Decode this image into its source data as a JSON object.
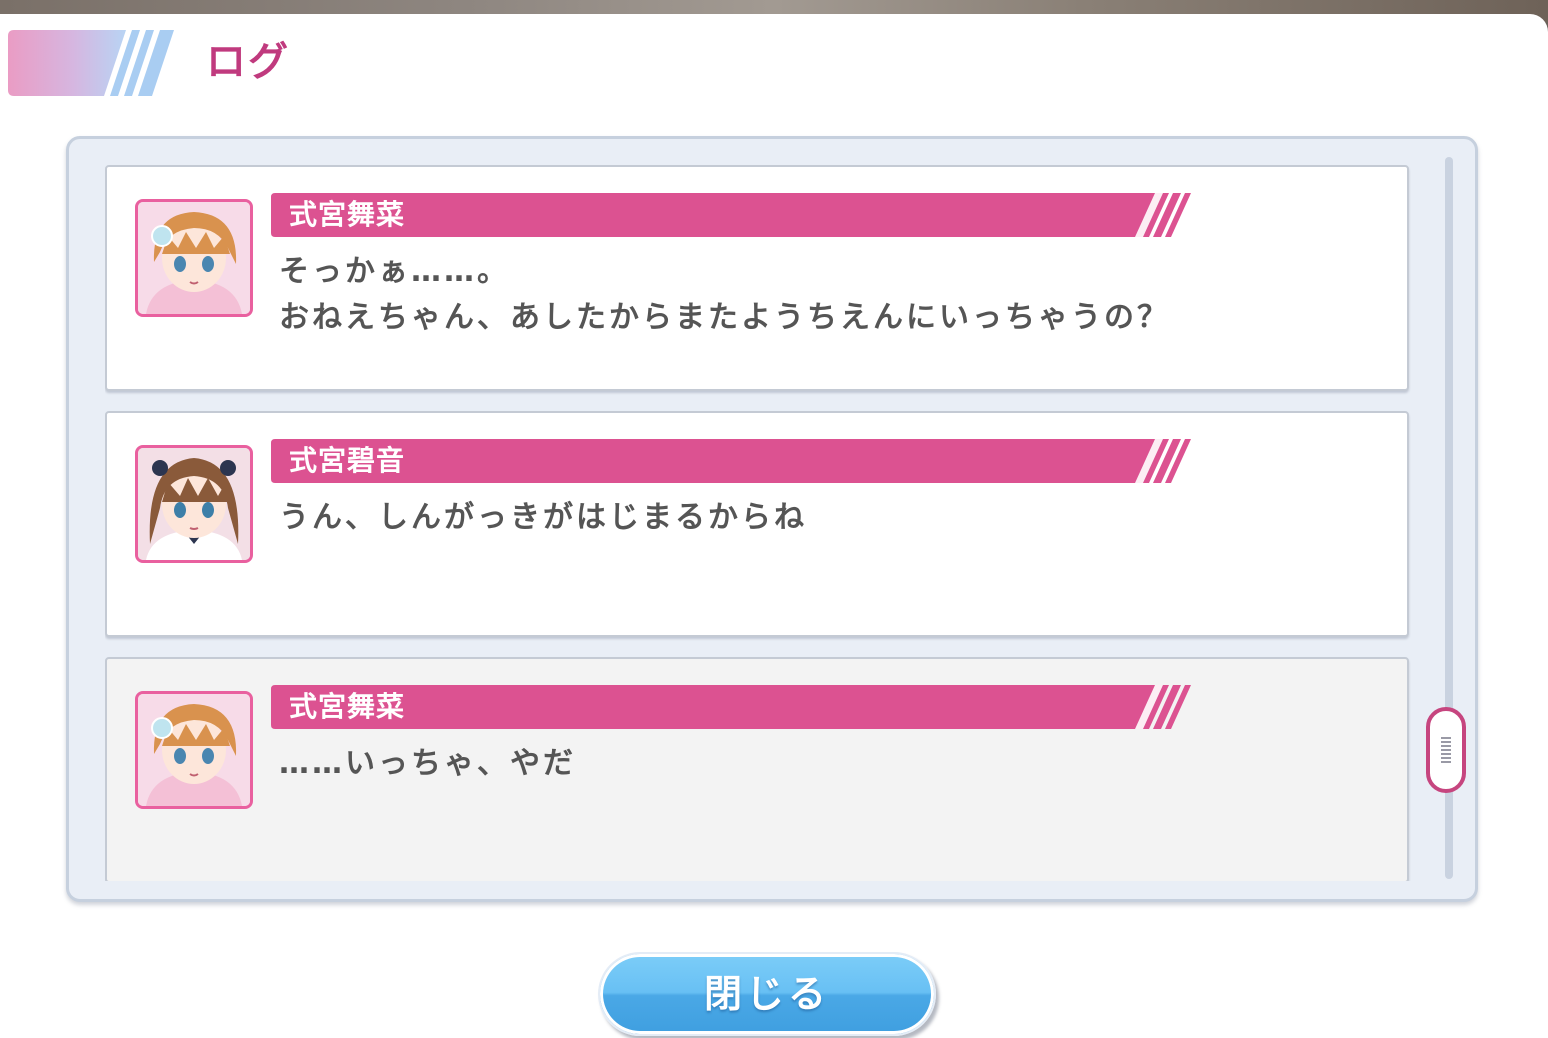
{
  "header": {
    "title": "ログ"
  },
  "log": {
    "entries": [
      {
        "speaker": "式宮舞菜",
        "avatar_icon": "character-portrait-mana",
        "lines": [
          "そっかぁ……。",
          "おねえちゃん、あしたからまたようちえんにいっちゃうの？"
        ]
      },
      {
        "speaker": "式宮碧音",
        "avatar_icon": "character-portrait-akane",
        "lines": [
          "うん、しんがっきがはじまるからね"
        ]
      },
      {
        "speaker": "式宮舞菜",
        "avatar_icon": "character-portrait-mana",
        "lines": [
          "……いっちゃ、やだ"
        ]
      }
    ]
  },
  "footer": {
    "close_label": "閉じる"
  },
  "colors": {
    "accent_pink": "#dc5291",
    "title_pink": "#c03a7e",
    "button_blue": "#4aa8e6",
    "panel_bg": "#e9eef6"
  }
}
